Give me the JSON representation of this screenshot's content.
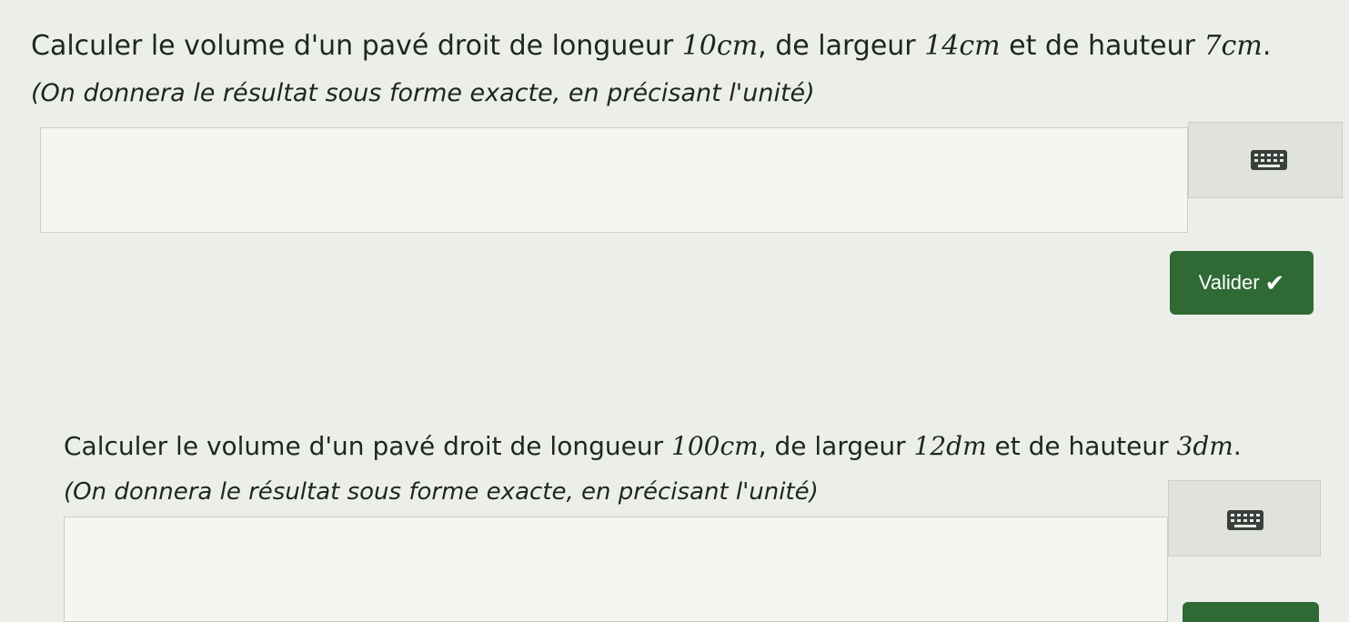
{
  "question1": {
    "line1_prefix": "Calculer le volume d'un pavé droit de longueur ",
    "length": "10cm",
    "mid1": ", de largeur ",
    "width": "14cm",
    "mid2": " et de hauteur ",
    "height": "7cm",
    "end": ".",
    "instruction": "(On donnera le résultat sous forme exacte, en précisant l'unité)",
    "answer_value": "",
    "submit_label": "Valider",
    "submit_icon": "check-icon"
  },
  "question2": {
    "line1_prefix": "Calculer le volume d'un pavé droit de longueur ",
    "length": "100cm",
    "mid1": ", de largeur ",
    "width": "12dm",
    "mid2": " et de hauteur ",
    "height": "3dm",
    "end": ".",
    "instruction": "(On donnera le résultat sous forme exacte, en précisant l'unité)",
    "answer_value": ""
  },
  "colors": {
    "button_bg": "#2f6a35",
    "page_bg": "#ecefe9"
  }
}
